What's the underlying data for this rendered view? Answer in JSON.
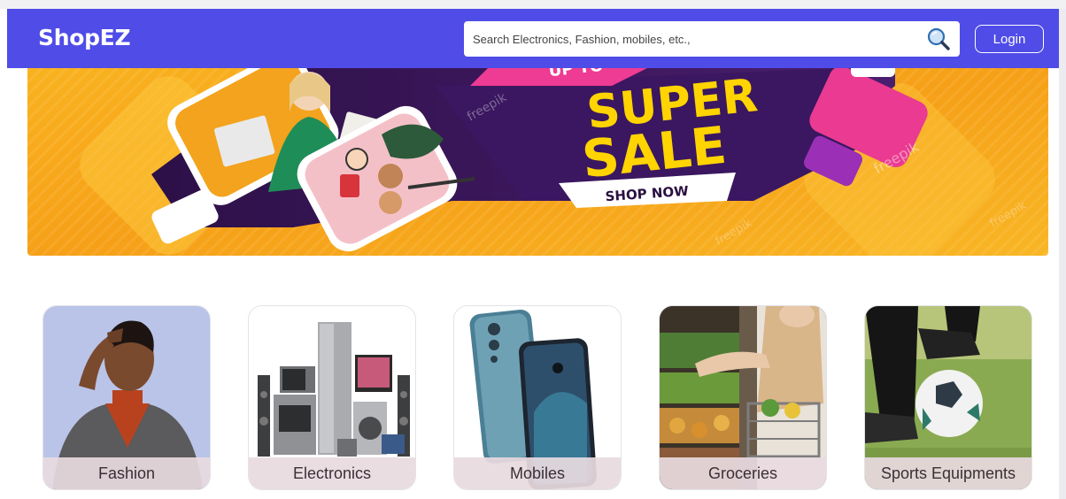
{
  "app": {
    "name": "ShopEZ"
  },
  "search": {
    "placeholder": "Search Electronics, Fashion, mobiles, etc.,"
  },
  "header": {
    "login_label": "Login"
  },
  "banner": {
    "line1": "SUPER",
    "line2": "SALE",
    "cta": "SHOP NOW",
    "top_partial": "UP TO",
    "watermark": "freepik"
  },
  "categories": [
    {
      "label": "Fashion",
      "icon": "fashion-photo"
    },
    {
      "label": "Electronics",
      "icon": "appliances-photo"
    },
    {
      "label": "Mobiles",
      "icon": "smartphone-photo"
    },
    {
      "label": "Groceries",
      "icon": "grocery-photo"
    },
    {
      "label": "Sports Equipments",
      "icon": "football-photo"
    }
  ],
  "colors": {
    "header": "#4f4ce8",
    "banner_orange": "#f7a51b",
    "banner_purple": "#3c1a5b",
    "banner_yellow": "#ffd400",
    "banner_pink": "#e8398c"
  }
}
